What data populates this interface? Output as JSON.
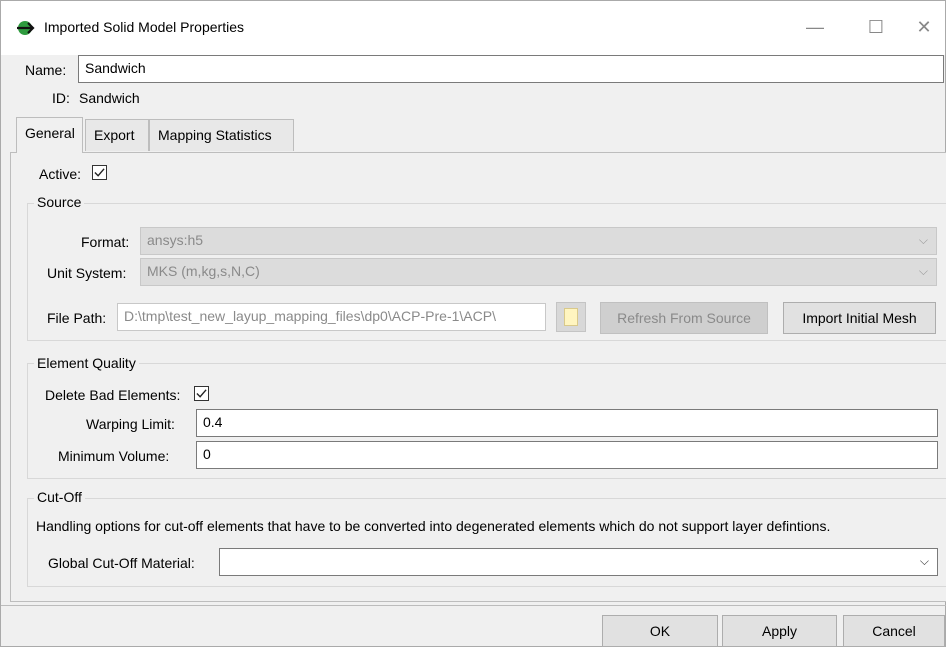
{
  "window": {
    "title": "Imported Solid Model Properties",
    "controls": {
      "minimize": "—",
      "maximize": "☐",
      "close": "✕"
    }
  },
  "header": {
    "name_label": "Name:",
    "name_value": "Sandwich",
    "id_label": "ID:",
    "id_value": "Sandwich"
  },
  "tabs": [
    {
      "label": "General",
      "selected": true
    },
    {
      "label": "Export",
      "selected": false
    },
    {
      "label": "Mapping Statistics",
      "selected": false
    }
  ],
  "general": {
    "active_label": "Active:",
    "active_checked": true,
    "source": {
      "title": "Source",
      "format_label": "Format:",
      "format_value": "ansys:h5",
      "unit_label": "Unit System:",
      "unit_value": "MKS (m,kg,s,N,C)",
      "filepath_label": "File Path:",
      "filepath_value": "D:\\tmp\\test_new_layup_mapping_files\\dp0\\ACP-Pre-1\\ACP\\",
      "refresh_label": "Refresh From Source",
      "import_label": "Import Initial Mesh"
    },
    "element_quality": {
      "title": "Element Quality",
      "delete_label": "Delete Bad Elements:",
      "delete_checked": true,
      "warping_label": "Warping Limit:",
      "warping_value": "0.4",
      "minvol_label": "Minimum Volume:",
      "minvol_value": "0"
    },
    "cutoff": {
      "title": "Cut-Off",
      "description": "Handling options for cut-off elements that have to be converted into degenerated elements which do not support layer defintions.",
      "material_label": "Global Cut-Off Material:",
      "material_value": ""
    }
  },
  "footer": {
    "ok_label": "OK",
    "apply_label": "Apply",
    "cancel_label": "Cancel"
  },
  "icons": [
    "app-icon",
    "chevron-down-icon",
    "checkmark-icon",
    "folder-icon"
  ]
}
